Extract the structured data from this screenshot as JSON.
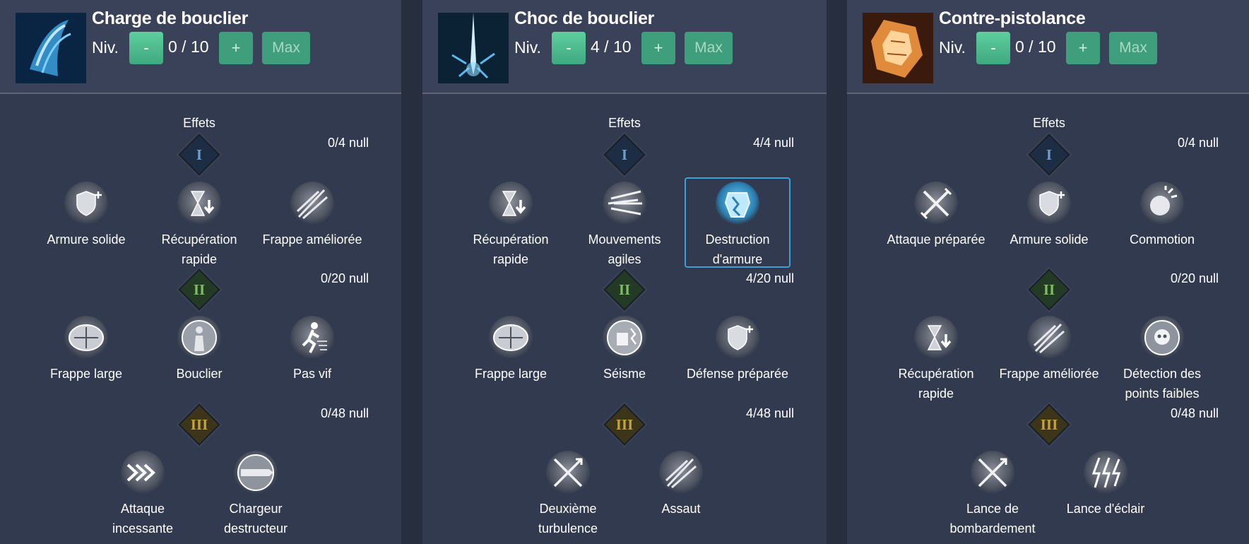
{
  "panels": [
    {
      "skill_name": "Charge de bouclier",
      "level_label": "Niv.",
      "level_value": "0 / 10",
      "minus_label": "-",
      "plus_label": "+",
      "max_label": "Max",
      "icon": "shield-charge-icon",
      "effects_title": "Effets",
      "tiers": [
        {
          "numeral": "I",
          "count": "0/4 null",
          "nodes": [
            {
              "label": "Armure solide",
              "icon": "shield-plus-icon"
            },
            {
              "label": "Récupération rapide",
              "icon": "hourglass-down-icon"
            },
            {
              "label": "Frappe améliorée",
              "icon": "slash-strike-icon"
            }
          ]
        },
        {
          "numeral": "II",
          "count": "0/20 null",
          "nodes": [
            {
              "label": "Frappe large",
              "icon": "wide-arrows-icon"
            },
            {
              "label": "Bouclier",
              "icon": "body-shield-icon"
            },
            {
              "label": "Pas vif",
              "icon": "running-figure-icon"
            }
          ]
        },
        {
          "numeral": "III",
          "count": "0/48 null",
          "nodes": [
            {
              "label": "Attaque incessante",
              "icon": "chevrons-right-icon"
            },
            {
              "label": "Chargeur destructeur",
              "icon": "lance-charge-icon"
            }
          ]
        }
      ]
    },
    {
      "skill_name": "Choc de bouclier",
      "level_label": "Niv.",
      "level_value": "4 / 10",
      "minus_label": "-",
      "plus_label": "+",
      "max_label": "Max",
      "icon": "shield-shock-icon",
      "effects_title": "Effets",
      "tiers": [
        {
          "numeral": "I",
          "count": "4/4 null",
          "nodes": [
            {
              "label": "Récupération rapide",
              "icon": "hourglass-down-icon"
            },
            {
              "label": "Mouvements agiles",
              "icon": "speed-lines-icon"
            },
            {
              "label": "Destruction d'armure",
              "icon": "armor-break-icon",
              "selected": true
            }
          ]
        },
        {
          "numeral": "II",
          "count": "4/20 null",
          "nodes": [
            {
              "label": "Frappe large",
              "icon": "wide-arrows-icon"
            },
            {
              "label": "Séisme",
              "icon": "quake-fist-icon"
            },
            {
              "label": "Défense préparée",
              "icon": "shield-plus-icon"
            }
          ]
        },
        {
          "numeral": "III",
          "count": "4/48 null",
          "nodes": [
            {
              "label": "Deuxième turbulence",
              "icon": "crossed-arrows-icon"
            },
            {
              "label": "Assaut",
              "icon": "slash-strike-icon"
            }
          ]
        }
      ]
    },
    {
      "skill_name": "Contre-pistolance",
      "level_label": "Niv.",
      "level_value": "0 / 10",
      "minus_label": "-",
      "plus_label": "+",
      "max_label": "Max",
      "icon": "counter-gunlance-icon",
      "effects_title": "Effets",
      "tiers": [
        {
          "numeral": "I",
          "count": "0/4 null",
          "nodes": [
            {
              "label": "Attaque préparée",
              "icon": "crossed-swords-icon"
            },
            {
              "label": "Armure solide",
              "icon": "shield-plus-icon"
            },
            {
              "label": "Commotion",
              "icon": "concussion-icon"
            }
          ]
        },
        {
          "numeral": "II",
          "count": "0/20 null",
          "nodes": [
            {
              "label": "Récupération rapide",
              "icon": "hourglass-down-icon"
            },
            {
              "label": "Frappe améliorée",
              "icon": "slash-strike-icon"
            },
            {
              "label": "Détection des points faibles",
              "icon": "skull-target-icon"
            }
          ]
        },
        {
          "numeral": "III",
          "count": "0/48 null",
          "nodes": [
            {
              "label": "Lance de bombardement",
              "icon": "crossed-arrows-icon"
            },
            {
              "label": "Lance d'éclair",
              "icon": "lightning-icon"
            }
          ]
        }
      ]
    }
  ]
}
